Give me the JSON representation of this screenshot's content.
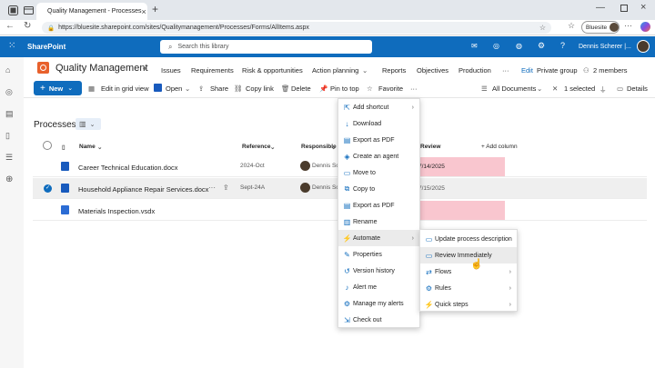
{
  "browser": {
    "tab_title": "Quality Management - Processes",
    "url": "https://bluesite.sharepoint.com/sites/Qualitymanagement/Processes/Forms/AllItems.aspx",
    "profile_label": "Bluesite"
  },
  "sp": {
    "app_name": "SharePoint",
    "search_placeholder": "Search this library",
    "user_name": "Dennis Scherer |..."
  },
  "site": {
    "title": "Quality Management",
    "nav": [
      "Issues",
      "Requirements",
      "Risk & opportunities",
      "Action planning",
      "Reports",
      "Objectives",
      "Production"
    ],
    "more": "···",
    "edit": "Edit",
    "group": "Private group",
    "members": "2 members"
  },
  "commands": {
    "new": "New",
    "edit_grid": "Edit in grid view",
    "open": "Open",
    "share": "Share",
    "copy_link": "Copy link",
    "delete": "Delete",
    "pin": "Pin to top",
    "favorite": "Favorite",
    "more": "···",
    "view": "All Documents",
    "selected": "1 selected",
    "details": "Details"
  },
  "library": {
    "title": "Processes",
    "columns": [
      "Name",
      "Reference",
      "Responsible",
      "Review",
      "+ Add column"
    ],
    "rows": [
      {
        "name": "Career Technical Education.docx",
        "ref": "2024-Oct",
        "resp": "Dennis Sch",
        "review": "7/14/2025"
      },
      {
        "name": "Household Appliance Repair Services.docx",
        "ref": "Sept-24A",
        "resp": "Dennis Sch",
        "review": "7/15/2025"
      },
      {
        "name": "Materials Inspection.vsdx",
        "ref": "",
        "resp": "",
        "review": ""
      }
    ]
  },
  "context_menu": [
    "Add shortcut",
    "Download",
    "Export as PDF",
    "Create an agent",
    "Move to",
    "Copy to",
    "Export as PDF",
    "Rename",
    "Automate",
    "Properties",
    "Version history",
    "Alert me",
    "Manage my alerts",
    "Check out"
  ],
  "automate_menu": [
    "Update process description",
    "Review Immediately",
    "Flows",
    "Rules",
    "Quick steps"
  ],
  "colors": {
    "accent": "#0f6cbd",
    "review_highlight": "#f9c6cf",
    "selected_row": "#efefef"
  }
}
